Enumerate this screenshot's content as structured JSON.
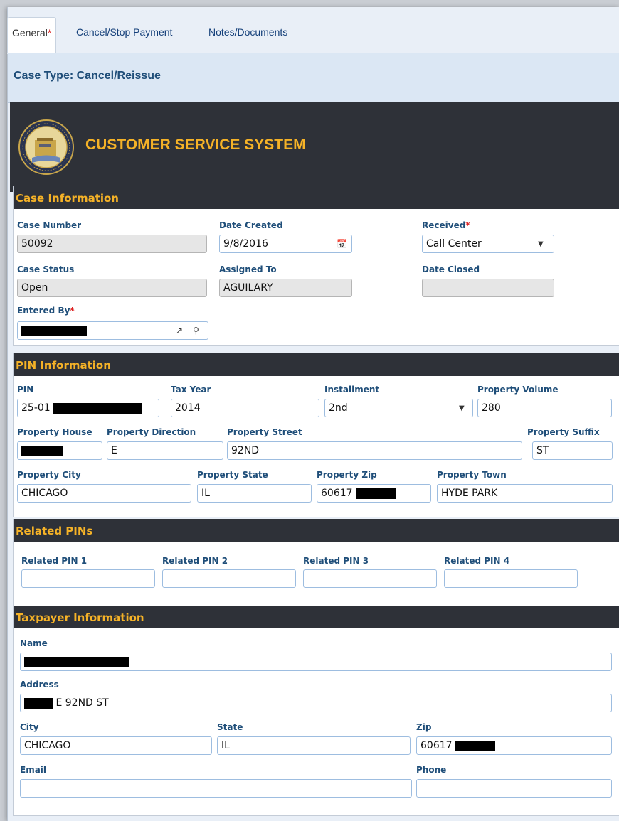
{
  "tabs": [
    {
      "label": "General",
      "required": "*"
    },
    {
      "label": "Cancel/Stop Payment"
    },
    {
      "label": "Notes/Documents"
    }
  ],
  "case_type": "Case Type: Cancel/Reissue",
  "banner": {
    "title": "CUSTOMER SERVICE SYSTEM",
    "seal_icon": "cook-county-seal-icon"
  },
  "case_info": {
    "title": "Case Information",
    "case_number": {
      "label": "Case Number",
      "value": "50092"
    },
    "date_created": {
      "label": "Date Created",
      "value": "9/8/2016"
    },
    "received": {
      "label": "Received",
      "required": "*",
      "value": "Call Center"
    },
    "case_status": {
      "label": "Case Status",
      "value": "Open"
    },
    "assigned_to": {
      "label": "Assigned To",
      "value": "AGUILARY"
    },
    "date_closed": {
      "label": "Date Closed",
      "value": ""
    },
    "entered_by": {
      "label": "Entered By",
      "required": "*",
      "value": ""
    }
  },
  "pin_info": {
    "title": "PIN Information",
    "pin": {
      "label": "PIN",
      "value": "25-01"
    },
    "tax_year": {
      "label": "Tax Year",
      "value": "2014"
    },
    "installment": {
      "label": "Installment",
      "value": "2nd"
    },
    "property_volume": {
      "label": "Property Volume",
      "value": "280"
    },
    "property_house": {
      "label": "Property House",
      "value": ""
    },
    "property_direction": {
      "label": "Property Direction",
      "value": "E"
    },
    "property_street": {
      "label": "Property Street",
      "value": "92ND"
    },
    "property_suffix": {
      "label": "Property Suffix",
      "value": "ST"
    },
    "property_city": {
      "label": "Property City",
      "value": "CHICAGO"
    },
    "property_state": {
      "label": "Property State",
      "value": "IL"
    },
    "property_zip": {
      "label": "Property Zip",
      "value": "60617"
    },
    "property_town": {
      "label": "Property Town",
      "value": "HYDE PARK"
    }
  },
  "related_pins": {
    "title": "Related PINs",
    "items": [
      {
        "label": "Related PIN 1",
        "value": ""
      },
      {
        "label": "Related PIN 2",
        "value": ""
      },
      {
        "label": "Related PIN 3",
        "value": ""
      },
      {
        "label": "Related PIN 4",
        "value": ""
      }
    ]
  },
  "taxpayer": {
    "title": "Taxpayer Information",
    "name": {
      "label": "Name",
      "value": ""
    },
    "address": {
      "label": "Address",
      "value": "E 92ND ST"
    },
    "city": {
      "label": "City",
      "value": "CHICAGO"
    },
    "state": {
      "label": "State",
      "value": "IL"
    },
    "zip": {
      "label": "Zip",
      "value": "60617"
    },
    "email": {
      "label": "Email",
      "value": ""
    },
    "phone": {
      "label": "Phone",
      "value": ""
    }
  },
  "colors": {
    "accent": "#f5b227",
    "header_dark": "#2e3138",
    "label_blue": "#1f4e79",
    "required": "#dd2222"
  }
}
